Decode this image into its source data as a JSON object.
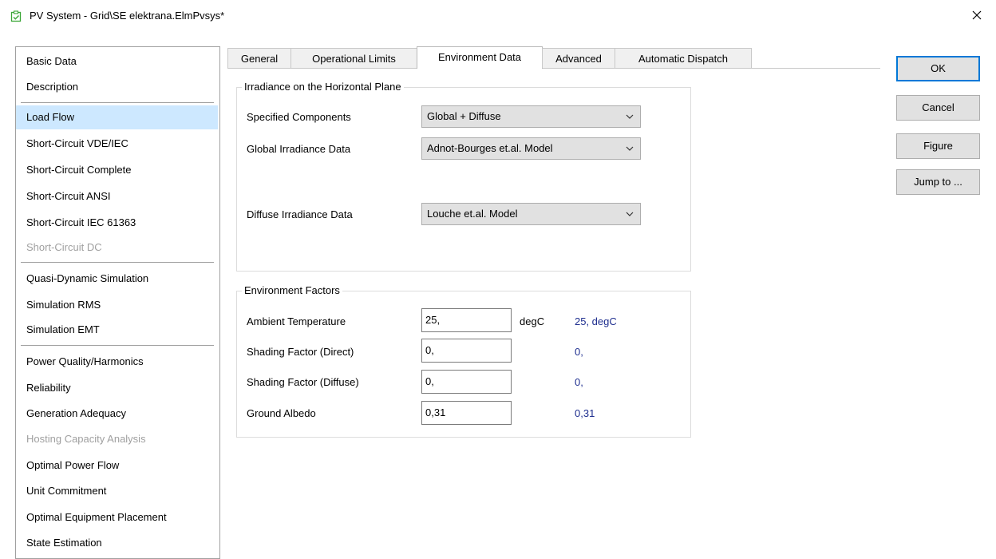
{
  "window": {
    "title": "PV System - Grid\\SE elektrana.ElmPvsys*"
  },
  "left_panel": {
    "items": [
      {
        "label": "Basic Data",
        "state": "normal"
      },
      {
        "label": "Description",
        "state": "normal"
      },
      {
        "label": "Load Flow",
        "state": "selected"
      },
      {
        "label": "Short-Circuit VDE/IEC",
        "state": "normal"
      },
      {
        "label": "Short-Circuit Complete",
        "state": "normal"
      },
      {
        "label": "Short-Circuit ANSI",
        "state": "normal"
      },
      {
        "label": "Short-Circuit IEC 61363",
        "state": "normal"
      },
      {
        "label": "Short-Circuit DC",
        "state": "disabled"
      },
      {
        "label": "Quasi-Dynamic Simulation",
        "state": "normal"
      },
      {
        "label": "Simulation RMS",
        "state": "normal"
      },
      {
        "label": "Simulation EMT",
        "state": "normal"
      },
      {
        "label": "Power Quality/Harmonics",
        "state": "normal"
      },
      {
        "label": "Reliability",
        "state": "normal"
      },
      {
        "label": "Generation Adequacy",
        "state": "normal"
      },
      {
        "label": "Hosting Capacity Analysis",
        "state": "disabled"
      },
      {
        "label": "Optimal Power Flow",
        "state": "normal"
      },
      {
        "label": "Unit Commitment",
        "state": "normal"
      },
      {
        "label": "Optimal Equipment Placement",
        "state": "normal"
      },
      {
        "label": "State Estimation",
        "state": "normal"
      }
    ]
  },
  "tabs": [
    {
      "label": "General",
      "active": false
    },
    {
      "label": "Operational Limits",
      "active": false
    },
    {
      "label": "Environment Data",
      "active": true
    },
    {
      "label": "Advanced",
      "active": false
    },
    {
      "label": "Automatic Dispatch",
      "active": false
    }
  ],
  "irradiance_group": {
    "title": "Irradiance on the Horizontal Plane",
    "specified_components_label": "Specified Components",
    "specified_components_value": "Global + Diffuse",
    "global_irradiance_label": "Global Irradiance Data",
    "global_irradiance_value": "Adnot-Bourges et.al. Model",
    "diffuse_irradiance_label": "Diffuse Irradiance Data",
    "diffuse_irradiance_value": "Louche et.al. Model"
  },
  "environment_group": {
    "title": "Environment Factors",
    "ambient_temperature_label": "Ambient Temperature",
    "ambient_temperature_value": "25,",
    "ambient_temperature_unit": "degC",
    "ambient_temperature_result": "25, degC",
    "shading_direct_label": "Shading Factor (Direct)",
    "shading_direct_value": "0,",
    "shading_direct_result": "0,",
    "shading_diffuse_label": "Shading Factor (Diffuse)",
    "shading_diffuse_value": "0,",
    "shading_diffuse_result": "0,",
    "ground_albedo_label": "Ground Albedo",
    "ground_albedo_value": "0,31",
    "ground_albedo_result": "0,31"
  },
  "buttons": {
    "ok": "OK",
    "cancel": "Cancel",
    "figure": "Figure",
    "jump_to": "Jump to ..."
  },
  "colors": {
    "selected_item_bg": "#cde8ff",
    "result_text": "#1f2f8f",
    "default_button_border": "#0078d7",
    "disabled_text": "#a0a0a0",
    "app_icon": "#3aa637"
  },
  "icons": {
    "app": "document-check-icon",
    "close": "close-icon",
    "dropdown": "chevron-down-icon"
  }
}
